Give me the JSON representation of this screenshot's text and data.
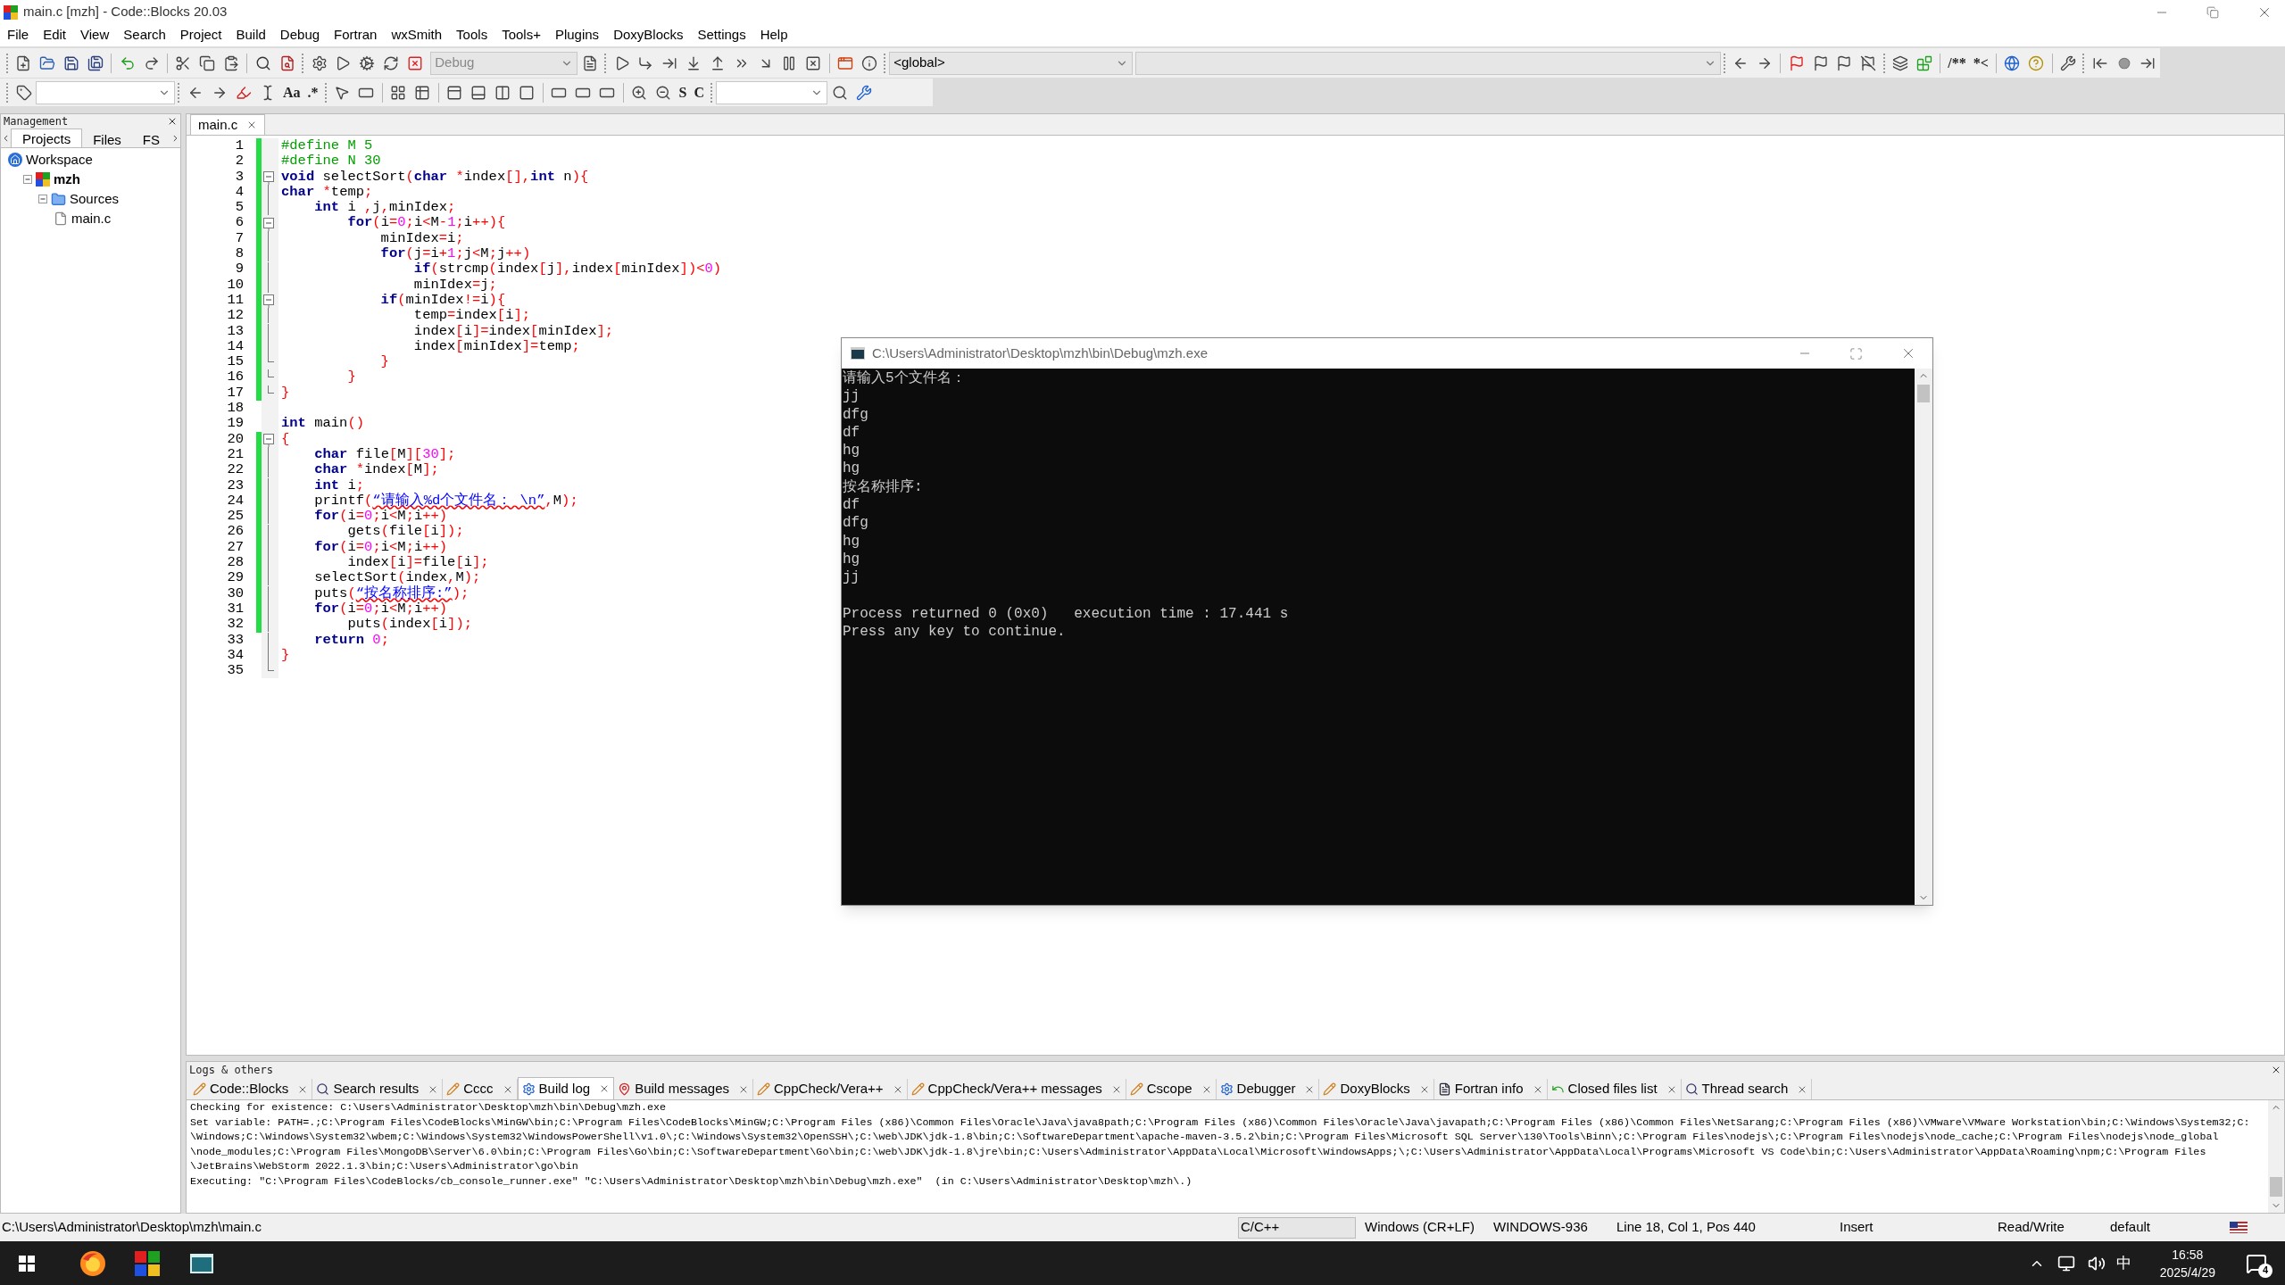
{
  "window": {
    "title": "main.c [mzh] - Code::Blocks 20.03"
  },
  "menu": [
    "File",
    "Edit",
    "View",
    "Search",
    "Project",
    "Build",
    "Debug",
    "Fortran",
    "wxSmith",
    "Tools",
    "Tools+",
    "Plugins",
    "DoxyBlocks",
    "Settings",
    "Help"
  ],
  "toolbar": {
    "build_target": "Debug",
    "scope": "<global>",
    "glyphs": [
      "Aa",
      ".*",
      "S",
      "C",
      "/**",
      "*<"
    ]
  },
  "management": {
    "title": "Management",
    "tabs": [
      {
        "label": "Projects",
        "selected": true
      },
      {
        "label": "Files",
        "selected": false
      },
      {
        "label": "FS",
        "selected": false
      }
    ],
    "tree": [
      {
        "label": "Workspace",
        "kind": "workspace",
        "active": false,
        "children": [
          {
            "label": "mzh",
            "kind": "project",
            "active": true,
            "expanded": true,
            "children": [
              {
                "label": "Sources",
                "kind": "folder",
                "active": false,
                "expanded": true,
                "children": [
                  {
                    "label": "main.c",
                    "kind": "file",
                    "active": false
                  }
                ]
              }
            ]
          }
        ]
      }
    ]
  },
  "editor": {
    "tabs": [
      {
        "label": "main.c",
        "selected": true
      }
    ],
    "lines": [
      {
        "n": "1",
        "changed": true,
        "in_fold": false,
        "fold_toggle": false,
        "fold_end": false,
        "segs": [
          {
            "kind": "pp",
            "text": "#define M 5"
          }
        ]
      },
      {
        "n": "2",
        "changed": true,
        "in_fold": false,
        "fold_toggle": false,
        "fold_end": false,
        "segs": [
          {
            "kind": "pp",
            "text": "#define N 30"
          }
        ]
      },
      {
        "n": "3",
        "changed": true,
        "in_fold": true,
        "fold_toggle": true,
        "fold_end": false,
        "segs": [
          {
            "kind": "kw",
            "text": "void"
          },
          {
            "kind": "plain",
            "text": " selectSort"
          },
          {
            "kind": "op",
            "text": "("
          },
          {
            "kind": "kw",
            "text": "char"
          },
          {
            "kind": "op",
            "text": " *"
          },
          {
            "kind": "plain",
            "text": "index"
          },
          {
            "kind": "op",
            "text": "[],"
          },
          {
            "kind": "kw",
            "text": "int"
          },
          {
            "kind": "plain",
            "text": " n"
          },
          {
            "kind": "op",
            "text": "){"
          }
        ]
      },
      {
        "n": "4",
        "changed": true,
        "in_fold": true,
        "fold_toggle": false,
        "fold_end": false,
        "segs": [
          {
            "kind": "kw",
            "text": "char"
          },
          {
            "kind": "op",
            "text": " *"
          },
          {
            "kind": "plain",
            "text": "temp"
          },
          {
            "kind": "op",
            "text": ";"
          }
        ]
      },
      {
        "n": "5",
        "changed": true,
        "in_fold": true,
        "fold_toggle": false,
        "fold_end": false,
        "segs": [
          {
            "kind": "kw",
            "text": "    int"
          },
          {
            "kind": "plain",
            "text": " i "
          },
          {
            "kind": "op",
            "text": ","
          },
          {
            "kind": "plain",
            "text": "j"
          },
          {
            "kind": "op",
            "text": ","
          },
          {
            "kind": "plain",
            "text": "minIdex"
          },
          {
            "kind": "op",
            "text": ";"
          }
        ]
      },
      {
        "n": "6",
        "changed": true,
        "in_fold": true,
        "fold_toggle": true,
        "fold_end": false,
        "segs": [
          {
            "kind": "kw",
            "text": "        for"
          },
          {
            "kind": "op",
            "text": "("
          },
          {
            "kind": "plain",
            "text": "i"
          },
          {
            "kind": "op",
            "text": "="
          },
          {
            "kind": "num",
            "text": "0"
          },
          {
            "kind": "op",
            "text": ";"
          },
          {
            "kind": "plain",
            "text": "i"
          },
          {
            "kind": "op",
            "text": "<"
          },
          {
            "kind": "plain",
            "text": "M"
          },
          {
            "kind": "op",
            "text": "-"
          },
          {
            "kind": "num",
            "text": "1"
          },
          {
            "kind": "op",
            "text": ";"
          },
          {
            "kind": "plain",
            "text": "i"
          },
          {
            "kind": "op",
            "text": "++){"
          }
        ]
      },
      {
        "n": "7",
        "changed": true,
        "in_fold": true,
        "fold_toggle": false,
        "fold_end": false,
        "segs": [
          {
            "kind": "plain",
            "text": "            minIdex"
          },
          {
            "kind": "op",
            "text": "="
          },
          {
            "kind": "plain",
            "text": "i"
          },
          {
            "kind": "op",
            "text": ";"
          }
        ]
      },
      {
        "n": "8",
        "changed": true,
        "in_fold": true,
        "fold_toggle": false,
        "fold_end": false,
        "segs": [
          {
            "kind": "kw",
            "text": "            for"
          },
          {
            "kind": "op",
            "text": "("
          },
          {
            "kind": "plain",
            "text": "j"
          },
          {
            "kind": "op",
            "text": "="
          },
          {
            "kind": "plain",
            "text": "i"
          },
          {
            "kind": "op",
            "text": "+"
          },
          {
            "kind": "num",
            "text": "1"
          },
          {
            "kind": "op",
            "text": ";"
          },
          {
            "kind": "plain",
            "text": "j"
          },
          {
            "kind": "op",
            "text": "<"
          },
          {
            "kind": "plain",
            "text": "M"
          },
          {
            "kind": "op",
            "text": ";"
          },
          {
            "kind": "plain",
            "text": "j"
          },
          {
            "kind": "op",
            "text": "++)"
          }
        ]
      },
      {
        "n": "9",
        "changed": true,
        "in_fold": true,
        "fold_toggle": false,
        "fold_end": false,
        "segs": [
          {
            "kind": "kw",
            "text": "                if"
          },
          {
            "kind": "op",
            "text": "("
          },
          {
            "kind": "plain",
            "text": "strcmp"
          },
          {
            "kind": "op",
            "text": "("
          },
          {
            "kind": "plain",
            "text": "index"
          },
          {
            "kind": "op",
            "text": "["
          },
          {
            "kind": "plain",
            "text": "j"
          },
          {
            "kind": "op",
            "text": "],"
          },
          {
            "kind": "plain",
            "text": "index"
          },
          {
            "kind": "op",
            "text": "["
          },
          {
            "kind": "plain",
            "text": "minIdex"
          },
          {
            "kind": "op",
            "text": "])<"
          },
          {
            "kind": "num",
            "text": "0"
          },
          {
            "kind": "op",
            "text": ")"
          }
        ]
      },
      {
        "n": "10",
        "changed": true,
        "in_fold": true,
        "fold_toggle": false,
        "fold_end": false,
        "segs": [
          {
            "kind": "plain",
            "text": "                minIdex"
          },
          {
            "kind": "op",
            "text": "="
          },
          {
            "kind": "plain",
            "text": "j"
          },
          {
            "kind": "op",
            "text": ";"
          }
        ]
      },
      {
        "n": "11",
        "changed": true,
        "in_fold": true,
        "fold_toggle": true,
        "fold_end": false,
        "segs": [
          {
            "kind": "kw",
            "text": "            if"
          },
          {
            "kind": "op",
            "text": "("
          },
          {
            "kind": "plain",
            "text": "minIdex"
          },
          {
            "kind": "op",
            "text": "!="
          },
          {
            "kind": "plain",
            "text": "i"
          },
          {
            "kind": "op",
            "text": "){"
          }
        ]
      },
      {
        "n": "12",
        "changed": true,
        "in_fold": true,
        "fold_toggle": false,
        "fold_end": false,
        "segs": [
          {
            "kind": "plain",
            "text": "                temp"
          },
          {
            "kind": "op",
            "text": "="
          },
          {
            "kind": "plain",
            "text": "index"
          },
          {
            "kind": "op",
            "text": "["
          },
          {
            "kind": "plain",
            "text": "i"
          },
          {
            "kind": "op",
            "text": "];"
          }
        ]
      },
      {
        "n": "13",
        "changed": true,
        "in_fold": true,
        "fold_toggle": false,
        "fold_end": false,
        "segs": [
          {
            "kind": "plain",
            "text": "                index"
          },
          {
            "kind": "op",
            "text": "["
          },
          {
            "kind": "plain",
            "text": "i"
          },
          {
            "kind": "op",
            "text": "]="
          },
          {
            "kind": "plain",
            "text": "index"
          },
          {
            "kind": "op",
            "text": "["
          },
          {
            "kind": "plain",
            "text": "minIdex"
          },
          {
            "kind": "op",
            "text": "];"
          }
        ]
      },
      {
        "n": "14",
        "changed": true,
        "in_fold": true,
        "fold_toggle": false,
        "fold_end": false,
        "segs": [
          {
            "kind": "plain",
            "text": "                index"
          },
          {
            "kind": "op",
            "text": "["
          },
          {
            "kind": "plain",
            "text": "minIdex"
          },
          {
            "kind": "op",
            "text": "]="
          },
          {
            "kind": "plain",
            "text": "temp"
          },
          {
            "kind": "op",
            "text": ";"
          }
        ]
      },
      {
        "n": "15",
        "changed": true,
        "in_fold": true,
        "fold_toggle": false,
        "fold_end": true,
        "segs": [
          {
            "kind": "op",
            "text": "            }"
          }
        ]
      },
      {
        "n": "16",
        "changed": true,
        "in_fold": true,
        "fold_toggle": false,
        "fold_end": true,
        "segs": [
          {
            "kind": "op",
            "text": "        }"
          }
        ]
      },
      {
        "n": "17",
        "changed": true,
        "in_fold": true,
        "fold_toggle": false,
        "fold_end": true,
        "segs": [
          {
            "kind": "op",
            "text": "}"
          }
        ]
      },
      {
        "n": "18",
        "changed": false,
        "in_fold": false,
        "fold_toggle": false,
        "fold_end": false
      },
      {
        "n": "19",
        "changed": false,
        "in_fold": false,
        "fold_toggle": false,
        "fold_end": false,
        "segs": [
          {
            "kind": "kw",
            "text": "int"
          },
          {
            "kind": "plain",
            "text": " main"
          },
          {
            "kind": "op",
            "text": "()"
          }
        ]
      },
      {
        "n": "20",
        "changed": true,
        "in_fold": true,
        "fold_toggle": true,
        "fold_end": false,
        "segs": [
          {
            "kind": "op",
            "text": "{"
          }
        ]
      },
      {
        "n": "21",
        "changed": true,
        "in_fold": true,
        "fold_toggle": false,
        "fold_end": false,
        "segs": [
          {
            "kind": "kw",
            "text": "    char"
          },
          {
            "kind": "plain",
            "text": " file"
          },
          {
            "kind": "op",
            "text": "["
          },
          {
            "kind": "plain",
            "text": "M"
          },
          {
            "kind": "op",
            "text": "]["
          },
          {
            "kind": "num",
            "text": "30"
          },
          {
            "kind": "op",
            "text": "];"
          }
        ]
      },
      {
        "n": "22",
        "changed": true,
        "in_fold": true,
        "fold_toggle": false,
        "fold_end": false,
        "segs": [
          {
            "kind": "kw",
            "text": "    char"
          },
          {
            "kind": "op",
            "text": " *"
          },
          {
            "kind": "plain",
            "text": "index"
          },
          {
            "kind": "op",
            "text": "["
          },
          {
            "kind": "plain",
            "text": "M"
          },
          {
            "kind": "op",
            "text": "];"
          }
        ]
      },
      {
        "n": "23",
        "changed": true,
        "in_fold": true,
        "fold_toggle": false,
        "fold_end": false,
        "segs": [
          {
            "kind": "kw",
            "text": "    int"
          },
          {
            "kind": "plain",
            "text": " i"
          },
          {
            "kind": "op",
            "text": ";"
          }
        ]
      },
      {
        "n": "24",
        "changed": true,
        "in_fold": true,
        "fold_toggle": false,
        "fold_end": false,
        "segs": [
          {
            "kind": "plain",
            "text": "    printf"
          },
          {
            "kind": "op",
            "text": "("
          },
          {
            "kind": "str",
            "text": "“请输入%d个文件名： \\n”"
          },
          {
            "kind": "op",
            "text": ","
          },
          {
            "kind": "plain",
            "text": "M"
          },
          {
            "kind": "op",
            "text": ");"
          }
        ]
      },
      {
        "n": "25",
        "changed": true,
        "in_fold": true,
        "fold_toggle": false,
        "fold_end": false,
        "segs": [
          {
            "kind": "kw",
            "text": "    for"
          },
          {
            "kind": "op",
            "text": "("
          },
          {
            "kind": "plain",
            "text": "i"
          },
          {
            "kind": "op",
            "text": "="
          },
          {
            "kind": "num",
            "text": "0"
          },
          {
            "kind": "op",
            "text": ";"
          },
          {
            "kind": "plain",
            "text": "i"
          },
          {
            "kind": "op",
            "text": "<"
          },
          {
            "kind": "plain",
            "text": "M"
          },
          {
            "kind": "op",
            "text": ";"
          },
          {
            "kind": "plain",
            "text": "i"
          },
          {
            "kind": "op",
            "text": "++)"
          }
        ]
      },
      {
        "n": "26",
        "changed": true,
        "in_fold": true,
        "fold_toggle": false,
        "fold_end": false,
        "segs": [
          {
            "kind": "plain",
            "text": "        gets"
          },
          {
            "kind": "op",
            "text": "("
          },
          {
            "kind": "plain",
            "text": "file"
          },
          {
            "kind": "op",
            "text": "["
          },
          {
            "kind": "plain",
            "text": "i"
          },
          {
            "kind": "op",
            "text": "]);"
          }
        ]
      },
      {
        "n": "27",
        "changed": true,
        "in_fold": true,
        "fold_toggle": false,
        "fold_end": false,
        "segs": [
          {
            "kind": "kw",
            "text": "    for"
          },
          {
            "kind": "op",
            "text": "("
          },
          {
            "kind": "plain",
            "text": "i"
          },
          {
            "kind": "op",
            "text": "="
          },
          {
            "kind": "num",
            "text": "0"
          },
          {
            "kind": "op",
            "text": ";"
          },
          {
            "kind": "plain",
            "text": "i"
          },
          {
            "kind": "op",
            "text": "<"
          },
          {
            "kind": "plain",
            "text": "M"
          },
          {
            "kind": "op",
            "text": ";"
          },
          {
            "kind": "plain",
            "text": "i"
          },
          {
            "kind": "op",
            "text": "++)"
          }
        ]
      },
      {
        "n": "28",
        "changed": true,
        "in_fold": true,
        "fold_toggle": false,
        "fold_end": false,
        "segs": [
          {
            "kind": "plain",
            "text": "        index"
          },
          {
            "kind": "op",
            "text": "["
          },
          {
            "kind": "plain",
            "text": "i"
          },
          {
            "kind": "op",
            "text": "]="
          },
          {
            "kind": "plain",
            "text": "file"
          },
          {
            "kind": "op",
            "text": "["
          },
          {
            "kind": "plain",
            "text": "i"
          },
          {
            "kind": "op",
            "text": "];"
          }
        ]
      },
      {
        "n": "29",
        "changed": true,
        "in_fold": true,
        "fold_toggle": false,
        "fold_end": false,
        "segs": [
          {
            "kind": "plain",
            "text": "    selectSort"
          },
          {
            "kind": "op",
            "text": "("
          },
          {
            "kind": "plain",
            "text": "index"
          },
          {
            "kind": "op",
            "text": ","
          },
          {
            "kind": "plain",
            "text": "M"
          },
          {
            "kind": "op",
            "text": ");"
          }
        ]
      },
      {
        "n": "30",
        "changed": true,
        "in_fold": true,
        "fold_toggle": false,
        "fold_end": false,
        "segs": [
          {
            "kind": "plain",
            "text": "    puts"
          },
          {
            "kind": "op",
            "text": "("
          },
          {
            "kind": "str",
            "text": "“按名称排序:”"
          },
          {
            "kind": "op",
            "text": ");"
          }
        ]
      },
      {
        "n": "31",
        "changed": true,
        "in_fold": true,
        "fold_toggle": false,
        "fold_end": false,
        "segs": [
          {
            "kind": "kw",
            "text": "    for"
          },
          {
            "kind": "op",
            "text": "("
          },
          {
            "kind": "plain",
            "text": "i"
          },
          {
            "kind": "op",
            "text": "="
          },
          {
            "kind": "num",
            "text": "0"
          },
          {
            "kind": "op",
            "text": ";"
          },
          {
            "kind": "plain",
            "text": "i"
          },
          {
            "kind": "op",
            "text": "<"
          },
          {
            "kind": "plain",
            "text": "M"
          },
          {
            "kind": "op",
            "text": ";"
          },
          {
            "kind": "plain",
            "text": "i"
          },
          {
            "kind": "op",
            "text": "++)"
          }
        ]
      },
      {
        "n": "32",
        "changed": true,
        "in_fold": true,
        "fold_toggle": false,
        "fold_end": false,
        "segs": [
          {
            "kind": "plain",
            "text": "        puts"
          },
          {
            "kind": "op",
            "text": "("
          },
          {
            "kind": "plain",
            "text": "index"
          },
          {
            "kind": "op",
            "text": "["
          },
          {
            "kind": "plain",
            "text": "i"
          },
          {
            "kind": "op",
            "text": "]);"
          }
        ]
      },
      {
        "n": "33",
        "changed": false,
        "in_fold": true,
        "fold_toggle": false,
        "fold_end": false,
        "segs": [
          {
            "kind": "kw",
            "text": "    return"
          },
          {
            "kind": "num",
            "text": " 0"
          },
          {
            "kind": "op",
            "text": ";"
          }
        ]
      },
      {
        "n": "34",
        "changed": false,
        "in_fold": true,
        "fold_toggle": false,
        "fold_end": false,
        "segs": [
          {
            "kind": "op",
            "text": "}"
          }
        ]
      },
      {
        "n": "35",
        "changed": false,
        "in_fold": true,
        "fold_toggle": false,
        "fold_end": true
      }
    ]
  },
  "console": {
    "title": "C:\\Users\\Administrator\\Desktop\\mzh\\bin\\Debug\\mzh.exe",
    "lines": [
      "请输入5个文件名：",
      "jj",
      "dfg",
      "df",
      "hg",
      "hg",
      "按名称排序:",
      "df",
      "dfg",
      "hg",
      "hg",
      "jj"
    ],
    "summary": [
      "Process returned 0 (0x0)   execution time : 17.441 s",
      "Press any key to continue."
    ]
  },
  "logs": {
    "title": "Logs & others",
    "tabs": [
      {
        "label": "Code::Blocks",
        "selected": false
      },
      {
        "label": "Search results",
        "selected": false
      },
      {
        "label": "Cccc",
        "selected": false
      },
      {
        "label": "Build log",
        "selected": true
      },
      {
        "label": "Build messages",
        "selected": false
      },
      {
        "label": "CppCheck/Vera++",
        "selected": false
      },
      {
        "label": "CppCheck/Vera++ messages",
        "selected": false
      },
      {
        "label": "Cscope",
        "selected": false
      },
      {
        "label": "Debugger",
        "selected": false
      },
      {
        "label": "DoxyBlocks",
        "selected": false
      },
      {
        "label": "Fortran info",
        "selected": false
      },
      {
        "label": "Closed files list",
        "selected": false
      },
      {
        "label": "Thread search",
        "selected": false
      }
    ],
    "lines": [
      "Checking for existence: C:\\Users\\Administrator\\Desktop\\mzh\\bin\\Debug\\mzh.exe",
      "Set variable: PATH=.;C:\\Program Files\\CodeBlocks\\MinGW\\bin;C:\\Program Files\\CodeBlocks\\MinGW;C:\\Program Files (x86)\\Common Files\\Oracle\\Java\\java8path;C:\\Program Files (x86)\\Common Files\\Oracle\\Java\\javapath;C:\\Program Files (x86)\\Common Files\\NetSarang;C:\\Program Files (x86)\\VMware\\VMware Workstation\\bin;C:\\Windows\\System32;C:",
      "\\Windows;C:\\Windows\\System32\\wbem;C:\\Windows\\System32\\WindowsPowerShell\\v1.0\\;C:\\Windows\\System32\\OpenSSH\\;C:\\web\\JDK\\jdk-1.8\\bin;C:\\SoftwareDepartment\\apache-maven-3.5.2\\bin;C:\\Program Files\\Microsoft SQL Server\\130\\Tools\\Binn\\;C:\\Program Files\\nodejs\\;C:\\Program Files\\nodejs\\node_cache;C:\\Program Files\\nodejs\\node_global",
      "\\node_modules;C:\\Program Files\\MongoDB\\Server\\6.0\\bin;C:\\Program Files\\Go\\bin;C:\\SoftwareDepartment\\Go\\bin;C:\\web\\JDK\\jdk-1.8\\jre\\bin;C:\\Users\\Administrator\\AppData\\Local\\Microsoft\\WindowsApps;\\;C:\\Users\\Administrator\\AppData\\Local\\Programs\\Microsoft VS Code\\bin;C:\\Users\\Administrator\\AppData\\Roaming\\npm;C:\\Program Files",
      "\\JetBrains\\WebStorm 2022.1.3\\bin;C:\\Users\\Administrator\\go\\bin",
      "Executing: \"C:\\Program Files\\CodeBlocks/cb_console_runner.exe\" \"C:\\Users\\Administrator\\Desktop\\mzh\\bin\\Debug\\mzh.exe\"  (in C:\\Users\\Administrator\\Desktop\\mzh\\.)"
    ]
  },
  "status_bar": {
    "path": "C:\\Users\\Administrator\\Desktop\\mzh\\main.c",
    "language": "C/C++",
    "eol": "Windows (CR+LF)",
    "encoding": "WINDOWS-936",
    "position": "Line 18, Col 1, Pos 440",
    "mode": "Insert",
    "access": "Read/Write",
    "theme": "default"
  },
  "taskbar": {
    "ime": "中",
    "time": "16:58",
    "date": "2025/4/29",
    "notifications": "4"
  }
}
